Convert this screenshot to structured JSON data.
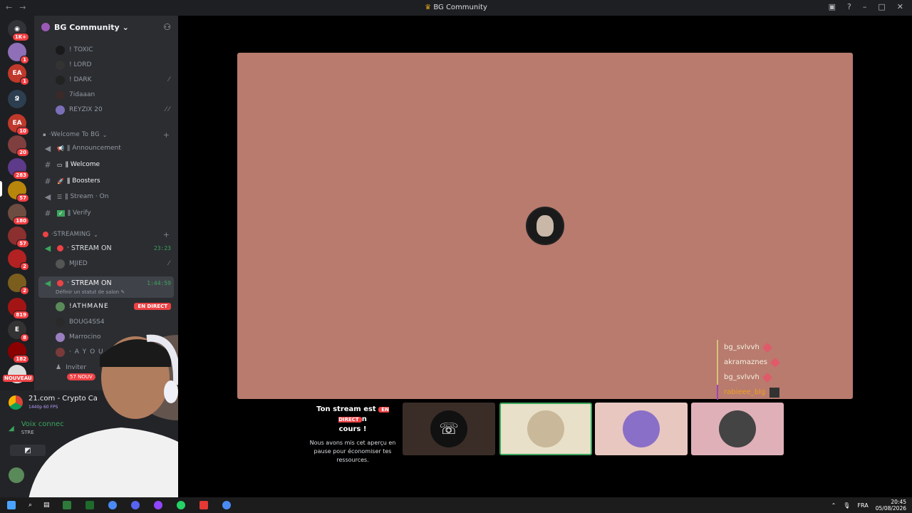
{
  "window": {
    "title": "BG Community"
  },
  "server": {
    "name": "BG Community"
  },
  "guild_badges": [
    "1K+",
    "1",
    "1",
    "",
    "10",
    "20",
    "283",
    "57",
    "180",
    "57",
    "2",
    "2",
    "819",
    "8",
    "182"
  ],
  "guild_new_label": "NOUVEAU",
  "members_top": [
    {
      "name": "! TOXIC"
    },
    {
      "name": "! LORD"
    },
    {
      "name": "! DARK"
    },
    {
      "name": "7idaaan"
    },
    {
      "name": "REYZIX 20"
    }
  ],
  "categories": {
    "welcome": "Welcome To BG",
    "streaming": "STREAMING"
  },
  "channels": [
    {
      "name": "ǁ Announcement",
      "icon": "megaphone-icon"
    },
    {
      "name": "ǁ Welcome",
      "icon": "hash-icon"
    },
    {
      "name": "ǁ Boosters",
      "icon": "hash-icon"
    },
    {
      "name": "ǁ Stream · On",
      "icon": "megaphone-icon"
    },
    {
      "name": "ǁ Verify",
      "icon": "hash-icon"
    }
  ],
  "voice_channels": [
    {
      "name": "STREAM ON",
      "time": "23:23"
    },
    {
      "name": "STREAM ON",
      "time": "1:44:59",
      "status": "Définir un statut de salon"
    }
  ],
  "voice_members": {
    "first": "MJIED",
    "second": [
      "!ATHMANE",
      "BOUG4SS4",
      "Marrocino",
      "· A Y O U"
    ],
    "invite": "Inviter",
    "live_label": "EN DIRECT",
    "new_count": "57 NOUV"
  },
  "bottom_panel": {
    "activity_title": "21.com - Crypto Ca",
    "activity_sub": "1440p 60 FPS",
    "voice_status": "Voix connec",
    "voice_channel": "STRE"
  },
  "stream": {
    "chat": [
      {
        "name": "bg_svlvvh"
      },
      {
        "name": "akramaznes"
      },
      {
        "name": "bg_svlvvh"
      },
      {
        "name": "rabieee_blg"
      }
    ],
    "paused_title_a": "Ton stream est",
    "paused_title_b": "n",
    "paused_title_c": "cours !",
    "paused_badge": "EN DIRECT",
    "paused_desc": "Nous avons mis cet aperçu en pause pour économiser tes ressources."
  },
  "taskbar": {
    "lang": "FRA",
    "time": "20:45",
    "date": "05/08/2026"
  },
  "colors": {
    "stage": "#b87b6e",
    "live": "#ed4245",
    "sidebar": "#2b2d31",
    "guilds": "#1e1f22"
  }
}
